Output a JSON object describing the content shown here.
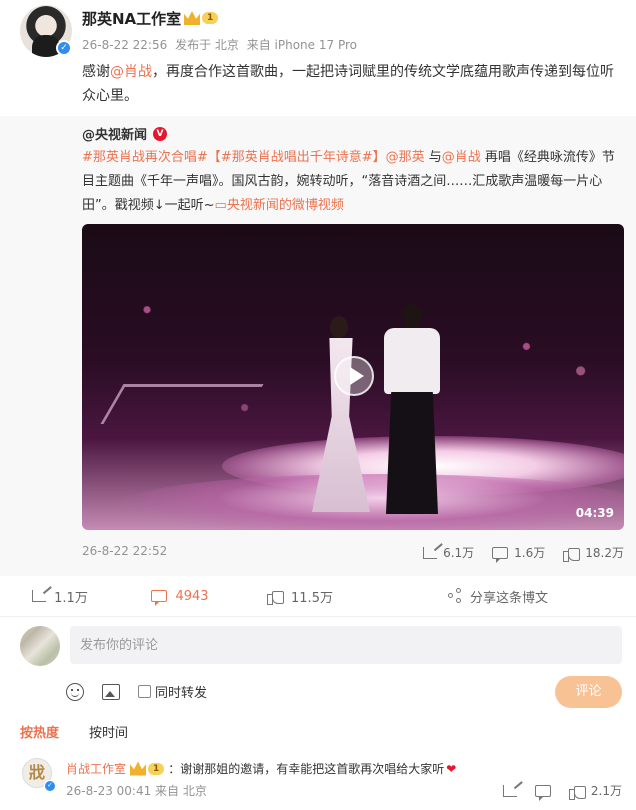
{
  "post": {
    "author": "那英NA工作室",
    "vip_level": "1",
    "timestamp": "26-8-22 22:56",
    "location": "发布于 北京",
    "device": "来自 iPhone 17 Pro",
    "content_prefix": "感谢",
    "mention": "@肖战",
    "content_suffix": "，再度合作这首歌曲，一起把诗词赋里的传统文学底蕴用歌声传递到每位听众心里。"
  },
  "repost": {
    "author": "@央视新闻",
    "hashtag1": "#那英肖战再次合唱#",
    "hashtag2": "【#那英肖战唱出千年诗意#】",
    "mention1": "@那英",
    "with": " 与",
    "mention2": "@肖战",
    "text": " 再唱《经典咏流传》节目主题曲《千年一声唱》。国风古韵，婉转动听，“落音诗酒之间……汇成歌声温暖每一片心田”。戳视频↓一起听~",
    "video_link": "央视新闻的微博视频",
    "video_duration": "04:39",
    "timestamp": "26-8-22 22:52",
    "shares": "6.1万",
    "comments": "1.6万",
    "likes": "18.2万"
  },
  "actions": {
    "forward": "1.1万",
    "comment": "4943",
    "like": "11.5万",
    "share": "分享这条博文"
  },
  "composer": {
    "placeholder": "发布你的评论",
    "forward_label": "同时转发",
    "submit_label": "评论"
  },
  "sort": {
    "hot": "按热度",
    "time": "按时间"
  },
  "comment": {
    "avatar_char": "戕",
    "author": "肖战工作室",
    "vip_level": "1",
    "text": "：谢谢那姐的邀请，有幸能把这首歌再次唱给大家听",
    "heart": "❤",
    "timestamp": "26-8-23 00:41 来自 北京",
    "likes": "2.1万"
  },
  "colors": {
    "accent": "#eb7350",
    "verified": "#2e8df0",
    "submit_disabled": "#f9c295"
  }
}
